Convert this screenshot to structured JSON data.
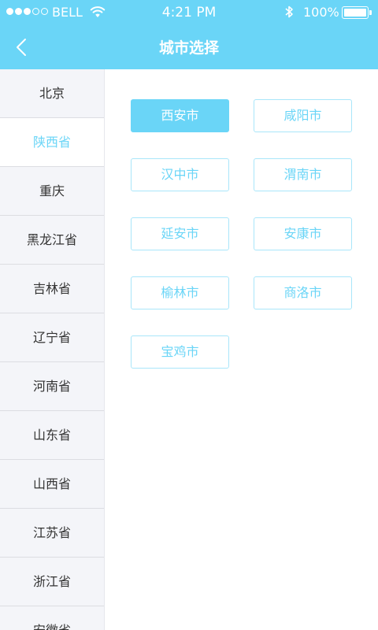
{
  "status_bar": {
    "carrier": "BELL",
    "time": "4:21 PM",
    "battery": "100%",
    "signal_filled": 3,
    "signal_total": 5,
    "icons": [
      "signal-icon",
      "wifi-icon",
      "bluetooth-icon",
      "battery-icon"
    ]
  },
  "nav": {
    "title": "城市选择",
    "back_icon": "chevron-left-icon"
  },
  "sidebar": {
    "active_index": 1,
    "items": [
      {
        "label": "北京"
      },
      {
        "label": "陕西省"
      },
      {
        "label": "重庆"
      },
      {
        "label": "黑龙江省"
      },
      {
        "label": "吉林省"
      },
      {
        "label": "辽宁省"
      },
      {
        "label": "河南省"
      },
      {
        "label": "山东省"
      },
      {
        "label": "山西省"
      },
      {
        "label": "江苏省"
      },
      {
        "label": "浙江省"
      },
      {
        "label": "安徽省"
      }
    ]
  },
  "cities": {
    "selected_index": 0,
    "items": [
      {
        "label": "西安市"
      },
      {
        "label": "咸阳市"
      },
      {
        "label": "汉中市"
      },
      {
        "label": "渭南市"
      },
      {
        "label": "延安市"
      },
      {
        "label": "安康市"
      },
      {
        "label": "榆林市"
      },
      {
        "label": "商洛市"
      },
      {
        "label": "宝鸡市"
      }
    ]
  },
  "colors": {
    "accent": "#6ad5f7",
    "sidebar_bg": "#f4f5f9",
    "text": "#333333"
  }
}
